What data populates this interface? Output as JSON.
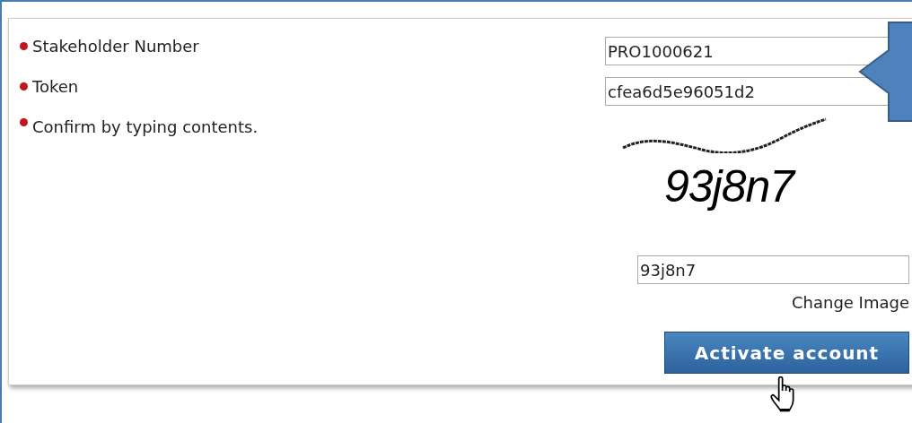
{
  "form": {
    "fields": [
      {
        "kind": "text",
        "label": "Stakeholder Number",
        "value": "PRO1000621"
      },
      {
        "kind": "text",
        "label": "Token",
        "value": "cfea6d5e96051d2"
      },
      {
        "kind": "captcha",
        "label": "Confirm by typing contents.",
        "captcha_text": "93j8n7",
        "value": "93j8n7",
        "link": "Change Image"
      }
    ],
    "button": "Activate account"
  }
}
